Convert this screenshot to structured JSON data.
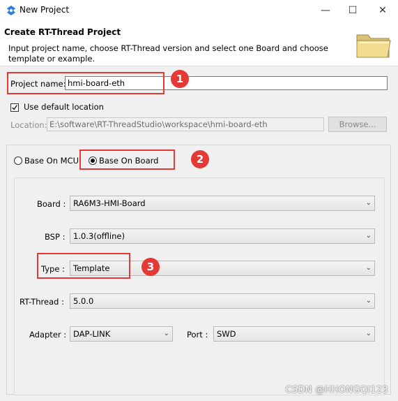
{
  "window": {
    "title": "New Project",
    "minimize_symbol": "—",
    "maximize_symbol": "☐",
    "close_symbol": "✕"
  },
  "header": {
    "title": "Create RT-Thread Project",
    "description": "Input project name, choose RT-Thread version and select one Board and choose template or example."
  },
  "project": {
    "name_label": "Project name:",
    "name_value": "hmi-board-eth",
    "use_default_label": "Use default location",
    "use_default_checked": true,
    "location_label": "Location:",
    "location_value": "E:\\software\\RT-ThreadStudio\\workspace\\hmi-board-eth",
    "browse_label": "Browse..."
  },
  "base": {
    "mcu_label": "Base On MCU",
    "board_label": "Base On Board",
    "selected": "board"
  },
  "fields": {
    "board_label": "Board :",
    "board_value": "RA6M3-HMI-Board",
    "bsp_label": "BSP :",
    "bsp_value": "1.0.3(offline)",
    "type_label": "Type :",
    "type_value": "Template",
    "rtthread_label": "RT-Thread :",
    "rtthread_value": "5.0.0",
    "adapter_label": "Adapter :",
    "adapter_value": "DAP-LINK",
    "port_label": "Port :",
    "port_value": "SWD"
  },
  "annotations": [
    "1",
    "2",
    "3"
  ],
  "watermark": "CSDN @HHONGQI123",
  "colors": {
    "annotation_red": "#e53935",
    "dialog_bg": "#f0f0f0",
    "header_bg": "#ffffff"
  }
}
